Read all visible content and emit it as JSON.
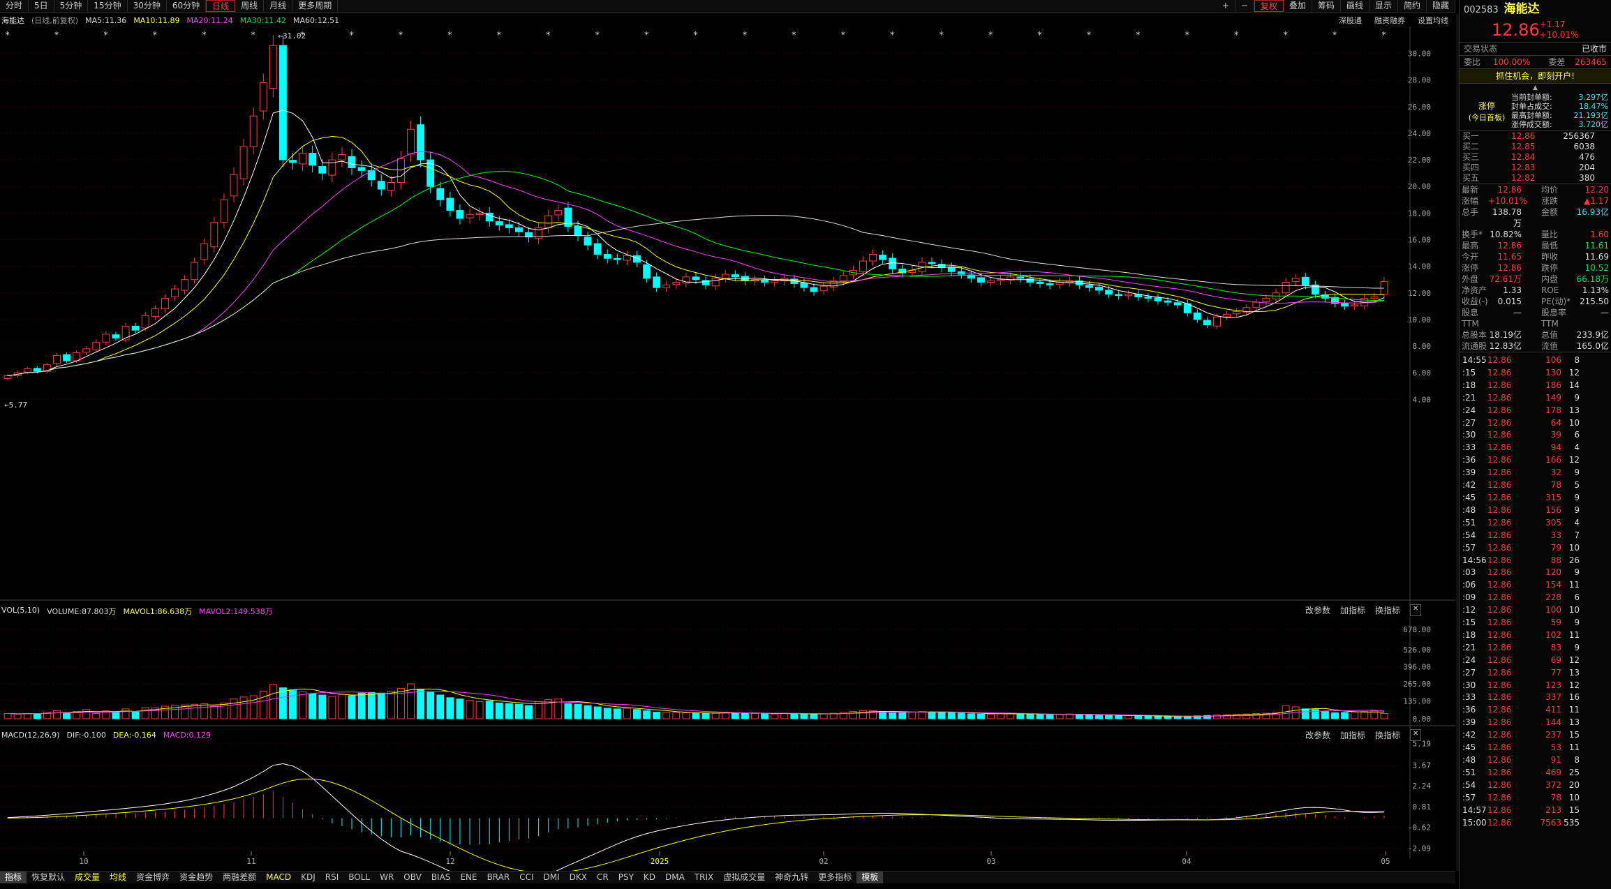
{
  "toolbar": {
    "tabs": [
      "分时",
      "5日",
      "5分钟",
      "15分钟",
      "30分钟",
      "60分钟",
      "日线",
      "周线",
      "月线",
      "更多周期"
    ],
    "active": "日线",
    "right": [
      "+",
      "−",
      "复权",
      "叠加",
      "筹码",
      "画线",
      "显示",
      "简约",
      "隐藏"
    ]
  },
  "info": {
    "name": "海能达",
    "period": "(日线,前复权)",
    "ma5": "MA5:11.36",
    "ma10": "MA10:11.89",
    "ma20": "MA20:11.24",
    "ma30": "MA30:11.42",
    "ma60": "MA60:12.51",
    "right": [
      "深股通",
      "融资融券",
      "设置均线"
    ]
  },
  "colors": {
    "up": "#ff3c3c",
    "down": "#00ffff",
    "ma5": "#ffffff",
    "ma10": "#ffff00",
    "ma20": "#ff40ff",
    "ma30": "#00ff00",
    "ma60": "#dddddd"
  },
  "annot": {
    "high": "←31.02",
    "low": "←5.77"
  },
  "vol": {
    "label": "VOL(5,10)",
    "volume": "VOLUME:87.803万",
    "mavol1": "MAVOL1:86.638万",
    "mavol2": "MAVOL2:149.538万",
    "tools": [
      "改参数",
      "加指标",
      "换指标"
    ]
  },
  "macd": {
    "label": "MACD(12,26,9)",
    "dif": "DIF:-0.100",
    "dea": "DEA:-0.164",
    "macd": "MACD:0.129",
    "tools": [
      "改参数",
      "加指标",
      "换指标"
    ]
  },
  "chart_data": [
    {
      "type": "candlestick",
      "title": "海能达",
      "yticks": [
        "30.00",
        "28.00",
        "26.00",
        "24.00",
        "22.00",
        "20.00",
        "18.00",
        "16.00",
        "14.00",
        "12.00",
        "10.00",
        "8.00",
        "6.00",
        "4.00"
      ],
      "ylim": [
        3.7,
        31.5
      ],
      "xticks": [
        "10",
        "11",
        "12",
        "2025",
        "02",
        "03",
        "04",
        "05"
      ],
      "high": 31.02,
      "low": 5.77,
      "close": [
        5.77,
        6.0,
        6.3,
        6.1,
        6.6,
        7.3,
        6.9,
        7.5,
        7.8,
        8.3,
        8.9,
        8.6,
        9.5,
        9.2,
        10.3,
        10.8,
        11.6,
        12.3,
        13.0,
        14.3,
        15.7,
        17.3,
        19.0,
        20.9,
        23.0,
        25.3,
        27.8,
        30.6,
        22.0,
        21.8,
        22.5,
        21.6,
        21.0,
        22.0,
        22.4,
        21.4,
        21.2,
        20.5,
        19.8,
        20.3,
        22.1,
        24.3,
        22.0,
        20.0,
        19.0,
        18.2,
        17.6,
        17.9,
        18.0,
        17.4,
        17.1,
        16.9,
        16.6,
        16.2,
        16.9,
        17.8,
        18.2,
        17.0,
        16.3,
        15.6,
        14.9,
        14.6,
        14.5,
        14.8,
        14.3,
        13.1,
        12.4,
        12.6,
        12.8,
        13.2,
        13.0,
        12.6,
        13.1,
        13.4,
        13.2,
        12.9,
        13.0,
        12.8,
        12.9,
        13.1,
        12.7,
        12.4,
        12.1,
        12.5,
        12.9,
        13.3,
        13.7,
        14.4,
        14.9,
        14.5,
        13.8,
        13.5,
        13.7,
        14.3,
        14.2,
        13.9,
        13.6,
        13.4,
        13.1,
        12.8,
        12.9,
        13.0,
        13.2,
        13.1,
        12.8,
        12.7,
        12.6,
        12.8,
        12.9,
        12.6,
        12.4,
        12.2,
        11.9,
        11.8,
        11.9,
        11.7,
        11.6,
        11.4,
        11.3,
        11.1,
        10.5,
        10.0,
        9.6,
        10.2,
        10.4,
        10.6,
        10.9,
        11.3,
        11.6,
        12.0,
        12.8,
        13.1,
        12.6,
        11.9,
        11.6,
        11.2,
        11.0,
        11.1,
        11.6,
        11.7,
        12.86
      ],
      "volume": [
        40,
        35,
        40,
        38,
        50,
        62,
        45,
        55,
        70,
        40,
        60,
        50,
        75,
        55,
        85,
        82,
        95,
        100,
        105,
        110,
        115,
        95,
        120,
        150,
        165,
        175,
        210,
        260,
        235,
        220,
        205,
        190,
        180,
        170,
        185,
        175,
        195,
        200,
        195,
        210,
        230,
        265,
        225,
        200,
        180,
        160,
        150,
        140,
        130,
        135,
        120,
        115,
        110,
        100,
        130,
        145,
        150,
        115,
        110,
        100,
        90,
        80,
        75,
        80,
        70,
        60,
        50,
        48,
        45,
        45,
        42,
        40,
        42,
        50,
        45,
        40,
        40,
        38,
        36,
        42,
        38,
        35,
        32,
        38,
        42,
        48,
        55,
        62,
        60,
        55,
        48,
        45,
        50,
        55,
        52,
        48,
        45,
        42,
        38,
        35,
        35,
        38,
        40,
        36,
        34,
        32,
        30,
        34,
        36,
        32,
        28,
        26,
        24,
        22,
        24,
        22,
        20,
        18,
        16,
        14,
        18,
        22,
        25,
        28,
        30,
        32,
        36,
        40,
        42,
        48,
        100,
        90,
        75,
        70,
        55,
        45,
        48,
        52,
        55,
        60,
        40
      ],
      "macd": [
        0.05,
        0.06,
        0.07,
        0.08,
        0.1,
        0.12,
        0.13,
        0.15,
        0.17,
        0.18,
        0.2,
        0.21,
        0.24,
        0.25,
        0.28,
        0.3,
        0.34,
        0.38,
        0.42,
        0.48,
        0.55,
        0.62,
        0.7,
        0.8,
        0.95,
        1.05,
        1.2,
        1.35,
        1.05,
        0.75,
        0.45,
        0.2,
        -0.05,
        -0.25,
        -0.4,
        -0.55,
        -0.7,
        -0.8,
        -0.9,
        -0.95,
        -0.95,
        -0.85,
        -0.95,
        -1.05,
        -1.15,
        -1.25,
        -1.3,
        -1.32,
        -1.3,
        -1.28,
        -1.2,
        -1.12,
        -1.05,
        -1.0,
        -0.88,
        -0.7,
        -0.55,
        -0.5,
        -0.45,
        -0.38,
        -0.3,
        -0.22,
        -0.15,
        -0.1,
        -0.08,
        -0.06,
        -0.05,
        -0.04,
        -0.02,
        0.0,
        0.02,
        0.03,
        0.04,
        0.05,
        0.06,
        0.06,
        0.07,
        0.07,
        0.08,
        0.08,
        0.07,
        0.07,
        0.06,
        0.07,
        0.08,
        0.09,
        0.1,
        0.11,
        0.1,
        0.09,
        0.08,
        0.06,
        0.05,
        0.04,
        0.03,
        0.02,
        0.01,
        0.0,
        -0.01,
        -0.02,
        -0.03,
        -0.04,
        -0.03,
        -0.03,
        -0.02,
        -0.02,
        -0.02,
        -0.03,
        -0.03,
        -0.04,
        -0.04,
        -0.05,
        -0.05,
        -0.04,
        -0.04,
        -0.03,
        -0.03,
        -0.02,
        -0.02,
        -0.02,
        -0.03,
        -0.04,
        -0.03,
        0.0,
        0.04,
        0.08,
        0.12,
        0.15,
        0.18,
        0.22,
        0.26,
        0.28,
        0.25,
        0.2,
        0.15,
        0.1,
        0.05,
        0.0,
        0.05,
        0.1,
        0.129
      ],
      "mavol1": "MAVOL1",
      "mavol2": "MAVOL2"
    }
  ],
  "vol_yticks": [
    "678.00",
    "526.00",
    "396.00",
    "265.00",
    "135.00",
    "0.00"
  ],
  "macd_yticks": [
    "5.19",
    "3.67",
    "2.24",
    "0.81",
    "-0.62",
    "-2.09"
  ],
  "bottom": [
    "指标",
    "恢复默认",
    "成交量",
    "均线",
    "资金博弈",
    "资金趋势",
    "两融差额",
    "MACD",
    "KDJ",
    "RSI",
    "BOLL",
    "WR",
    "OBV",
    "BIAS",
    "ENE",
    "BRAR",
    "CCI",
    "DMI",
    "DKX",
    "CR",
    "PSY",
    "KD",
    "DMA",
    "TRIX",
    "虚拟成交量",
    "神奇九转",
    "更多指标",
    "模板"
  ],
  "side": {
    "code": "002583",
    "name": "海能达",
    "price": "12.86",
    "change": "+1.17",
    "pct": "+10.01%",
    "status_label": "交易状态",
    "status": "已收市",
    "weibi_label": "委比",
    "weibi": "100.00%",
    "weicha_label": "委差",
    "weicha": "263465",
    "ad": "抓住机会，即刻开户!",
    "limit": {
      "tag": "涨停",
      "sub": "(今日首板)",
      "rows": [
        [
          "当前封单额:",
          "3.297亿"
        ],
        [
          "封单占成交:",
          "18.47%"
        ],
        [
          "最高封单额:",
          "21.193亿"
        ],
        [
          "涨停成交额:",
          "3.720亿"
        ]
      ]
    },
    "bids": [
      [
        "买一",
        "12.86",
        "256367"
      ],
      [
        "买二",
        "12.85",
        "6038"
      ],
      [
        "买三",
        "12.84",
        "476"
      ],
      [
        "买四",
        "12.83",
        "204"
      ],
      [
        "买五",
        "12.82",
        "380"
      ]
    ],
    "stats": [
      [
        "最新",
        "12.86",
        "均价",
        "12.20"
      ],
      [
        "涨幅",
        "+10.01%",
        "涨跌",
        "▲1.17"
      ],
      [
        "总手",
        "138.78万",
        "金额",
        "16.93亿"
      ],
      [
        "换手*",
        "10.82%",
        "量比",
        "1.60"
      ],
      [
        "最高",
        "12.86",
        "最低",
        "11.61"
      ],
      [
        "今开",
        "11.65",
        "昨收",
        "11.69"
      ],
      [
        "涨停",
        "12.86",
        "跌停",
        "10.52"
      ],
      [
        "外盘",
        "72.61万",
        "内盘",
        "66.18万"
      ],
      [
        "净资产",
        "1.33",
        "ROE",
        "1.13%"
      ],
      [
        "收益(-)",
        "0.015",
        "PE(动)*",
        "215.50"
      ],
      [
        "股息TTM",
        "—",
        "股息率TTM",
        "—"
      ],
      [
        "总股本",
        "18.19亿",
        "总值",
        "233.9亿"
      ],
      [
        "流通股",
        "12.83亿",
        "流值",
        "165.0亿"
      ]
    ],
    "ticks": [
      [
        "14:55",
        "12.86",
        "106",
        "8"
      ],
      [
        ":15",
        "12.86",
        "130",
        "12"
      ],
      [
        ":18",
        "12.86",
        "186",
        "14"
      ],
      [
        ":21",
        "12.86",
        "149",
        "9"
      ],
      [
        ":24",
        "12.86",
        "178",
        "13"
      ],
      [
        ":27",
        "12.86",
        "64",
        "10"
      ],
      [
        ":30",
        "12.86",
        "39",
        "6"
      ],
      [
        ":33",
        "12.86",
        "94",
        "4"
      ],
      [
        ":36",
        "12.86",
        "166",
        "12"
      ],
      [
        ":39",
        "12.86",
        "32",
        "9"
      ],
      [
        ":42",
        "12.86",
        "78",
        "5"
      ],
      [
        ":45",
        "12.86",
        "315",
        "9"
      ],
      [
        ":48",
        "12.86",
        "156",
        "9"
      ],
      [
        ":51",
        "12.86",
        "305",
        "4"
      ],
      [
        ":54",
        "12.86",
        "33",
        "7"
      ],
      [
        ":57",
        "12.86",
        "79",
        "10"
      ],
      [
        "14:56",
        "12.86",
        "88",
        "26"
      ],
      [
        ":03",
        "12.86",
        "120",
        "9"
      ],
      [
        ":06",
        "12.86",
        "154",
        "11"
      ],
      [
        ":09",
        "12.86",
        "228",
        "6"
      ],
      [
        ":12",
        "12.86",
        "100",
        "10"
      ],
      [
        ":15",
        "12.86",
        "59",
        "9"
      ],
      [
        ":18",
        "12.86",
        "102",
        "11"
      ],
      [
        ":21",
        "12.86",
        "83",
        "9"
      ],
      [
        ":24",
        "12.86",
        "69",
        "12"
      ],
      [
        ":27",
        "12.86",
        "77",
        "13"
      ],
      [
        ":30",
        "12.86",
        "123",
        "12"
      ],
      [
        ":33",
        "12.86",
        "337",
        "16"
      ],
      [
        ":36",
        "12.86",
        "411",
        "11"
      ],
      [
        ":39",
        "12.86",
        "144",
        "13"
      ],
      [
        ":42",
        "12.86",
        "237",
        "15"
      ],
      [
        ":45",
        "12.86",
        "53",
        "11"
      ],
      [
        ":48",
        "12.86",
        "91",
        "8"
      ],
      [
        ":51",
        "12.86",
        "469",
        "25"
      ],
      [
        ":54",
        "12.86",
        "372",
        "20"
      ],
      [
        ":57",
        "12.86",
        "78",
        "10"
      ],
      [
        "14:57",
        "12.86",
        "213",
        "15"
      ],
      [
        "15:00",
        "12.86",
        "7563",
        "535"
      ]
    ]
  }
}
